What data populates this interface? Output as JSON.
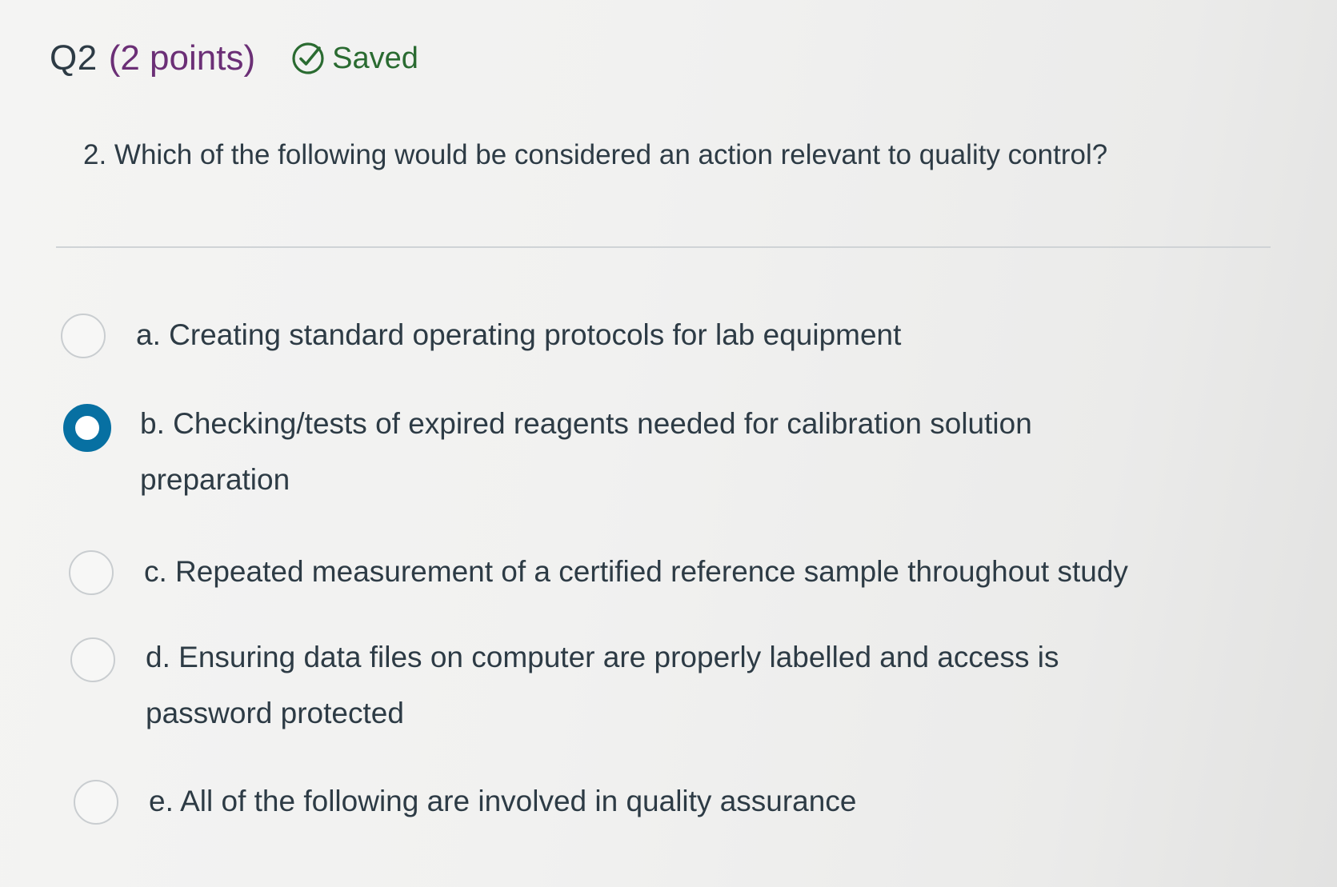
{
  "header": {
    "question_number": "Q2",
    "points": "(2 points)",
    "saved_label": "Saved"
  },
  "question": {
    "text": "2. Which of the following would be considered an action relevant to quality control?"
  },
  "answers": [
    {
      "text": "a. Creating standard operating protocols for lab equipment",
      "selected": false
    },
    {
      "text": "b. Checking/tests of expired reagents needed for calibration solution preparation",
      "selected": true
    },
    {
      "text": "c. Repeated measurement of a certified reference sample throughout study",
      "selected": false
    },
    {
      "text": "d. Ensuring data files on computer are properly labelled and access is password protected",
      "selected": false
    },
    {
      "text": "e. All of the following are involved in quality assurance",
      "selected": false
    }
  ],
  "colors": {
    "selected_radio": "#0770a2",
    "points_text": "#6b2f76",
    "saved_text": "#2a6b31"
  }
}
